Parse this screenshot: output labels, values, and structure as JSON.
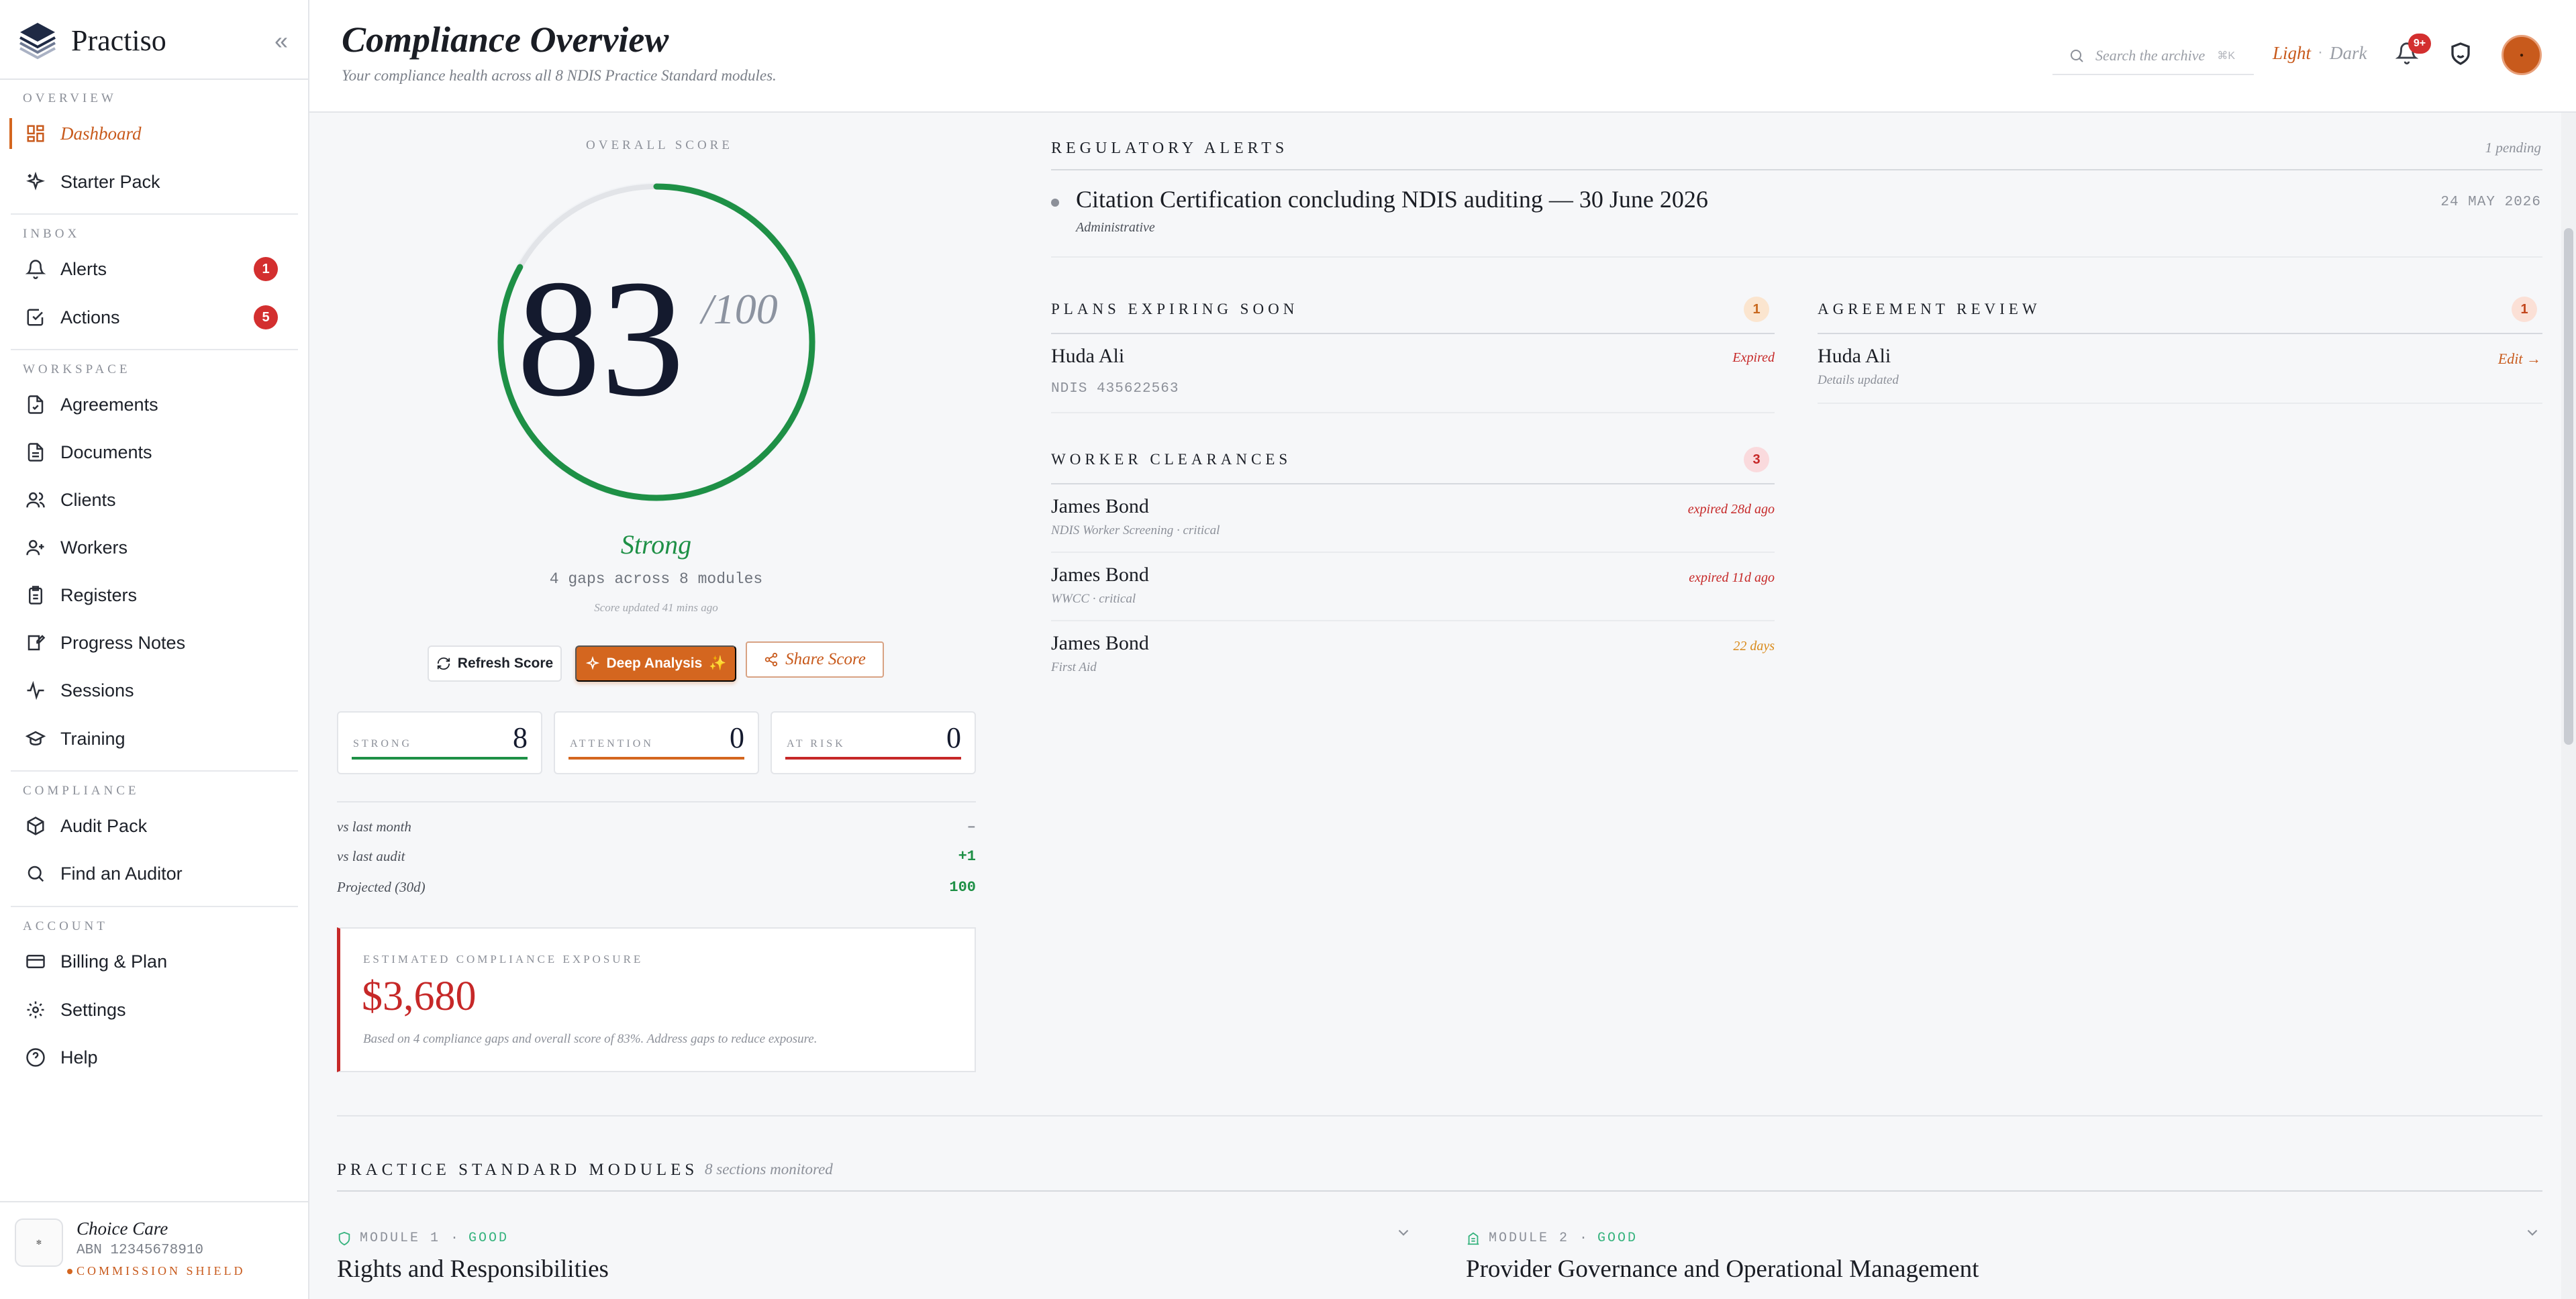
{
  "app": {
    "name": "Practiso"
  },
  "sidebar": {
    "sections": [
      "OVERVIEW",
      "INBOX",
      "WORKSPACE",
      "COMPLIANCE",
      "ACCOUNT"
    ],
    "items": [
      {
        "label": "Dashboard",
        "icon": "dashboard-icon"
      },
      {
        "label": "Starter Pack",
        "icon": "sparkle-icon"
      },
      {
        "label": "Alerts",
        "icon": "bell-icon",
        "badge": "1"
      },
      {
        "label": "Actions",
        "icon": "check-square-icon",
        "badge": "5"
      },
      {
        "label": "Agreements",
        "icon": "file-check-icon"
      },
      {
        "label": "Documents",
        "icon": "document-icon"
      },
      {
        "label": "Clients",
        "icon": "users-icon"
      },
      {
        "label": "Workers",
        "icon": "user-plus-icon"
      },
      {
        "label": "Registers",
        "icon": "clipboard-icon"
      },
      {
        "label": "Progress Notes",
        "icon": "notes-icon"
      },
      {
        "label": "Sessions",
        "icon": "activity-icon"
      },
      {
        "label": "Training",
        "icon": "graduation-cap-icon"
      },
      {
        "label": "Audit Pack",
        "icon": "package-icon"
      },
      {
        "label": "Find an Auditor",
        "icon": "search-icon"
      },
      {
        "label": "Billing & Plan",
        "icon": "credit-card-icon"
      },
      {
        "label": "Settings",
        "icon": "gear-icon"
      },
      {
        "label": "Help",
        "icon": "help-circle-icon"
      }
    ],
    "org": {
      "name": "Choice Care",
      "abn": "ABN 12345678910",
      "plan": "COMMISSION SHIELD"
    }
  },
  "header": {
    "title": "Compliance Overview",
    "subtitle": "Your compliance health across all 8 NDIS Practice Standard modules.",
    "search_placeholder": "Search the archive",
    "search_shortcut": "⌘K",
    "theme_light": "Light",
    "theme_sep": "·",
    "theme_dark": "Dark",
    "notifications_badge": "9+"
  },
  "score": {
    "label": "OVERALL SCORE",
    "value": "83",
    "max": "/100",
    "fraction": 0.83,
    "status": "Strong",
    "gaps": "4 gaps across 8 modules",
    "updated": "Score updated 41 mins ago",
    "buttons": {
      "refresh": "Refresh Score",
      "deep": "Deep Analysis",
      "share": "Share Score"
    },
    "stats": [
      {
        "label": "STRONG",
        "value": "8",
        "color": "#1e9046"
      },
      {
        "label": "ATTENTION",
        "value": "0",
        "color": "#d4661f"
      },
      {
        "label": "AT RISK",
        "value": "0",
        "color": "#c62828"
      }
    ],
    "comparisons": [
      {
        "label": "vs last month",
        "value": "–",
        "color": "#8c9099"
      },
      {
        "label": "vs last audit",
        "value": "+1",
        "color": "#1e9046"
      },
      {
        "label": "Projected (30d)",
        "value": "100",
        "color": "#1e9046"
      }
    ],
    "exposure": {
      "label": "ESTIMATED COMPLIANCE EXPOSURE",
      "value": "$3,680",
      "note": "Based on 4 compliance gaps and overall score of 83%. Address gaps to reduce exposure."
    }
  },
  "regulatory": {
    "title": "REGULATORY ALERTS",
    "pending": "1 pending",
    "alert": {
      "title": "Citation Certification concluding NDIS auditing — 30 June 2026",
      "category": "Administrative",
      "date": "24 MAY 2026"
    }
  },
  "plans": {
    "title": "PLANS EXPIRING SOON",
    "count": "1",
    "items": [
      {
        "name": "Huda Ali",
        "sub": "NDIS 435622563",
        "status": "Expired"
      }
    ]
  },
  "agreements": {
    "title": "AGREEMENT REVIEW",
    "count": "1",
    "items": [
      {
        "name": "Huda Ali",
        "sub": "Details updated",
        "action": "Edit →"
      }
    ]
  },
  "workers": {
    "title": "WORKER CLEARANCES",
    "count": "3",
    "items": [
      {
        "name": "James Bond",
        "sub": "NDIS Worker Screening · critical",
        "status": "expired 28d ago"
      },
      {
        "name": "James Bond",
        "sub": "WWCC · critical",
        "status": "expired 11d ago"
      },
      {
        "name": "James Bond",
        "sub": "First Aid",
        "status": "22 days"
      }
    ]
  },
  "modules": {
    "title": "PRACTICE STANDARD MODULES",
    "subtitle": "8 sections monitored",
    "items": [
      {
        "tag": "MODULE 1 ·",
        "status": "GOOD",
        "name": "Rights and Responsibilities"
      },
      {
        "tag": "MODULE 2 ·",
        "status": "GOOD",
        "name": "Provider Governance and Operational Management"
      }
    ]
  }
}
